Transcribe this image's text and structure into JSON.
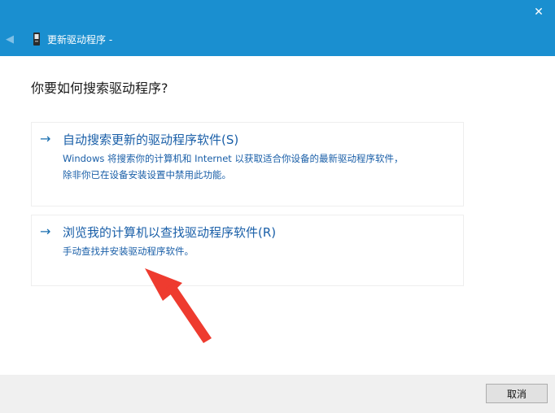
{
  "titlebar": {
    "title": "更新驱动程序 -",
    "close_glyph": "✕",
    "back_glyph": "◀",
    "color": "#1a8fd0"
  },
  "main": {
    "heading": "你要如何搜索驱动程序?",
    "arrow_glyph": "→",
    "options": [
      {
        "title": "自动搜索更新的驱动程序软件(S)",
        "desc_lines": [
          "Windows 将搜索你的计算机和 Internet 以获取适合你设备的最新驱动程序软件，",
          "除非你已在设备安装设置中禁用此功能。"
        ]
      },
      {
        "title": "浏览我的计算机以查找驱动程序软件(R)",
        "desc_lines": [
          "手动查找并安装驱动程序软件。"
        ]
      }
    ],
    "link_color": "#1a5fa8",
    "annotation_color": "#ee3b2f"
  },
  "footer": {
    "cancel_label": "取消"
  }
}
